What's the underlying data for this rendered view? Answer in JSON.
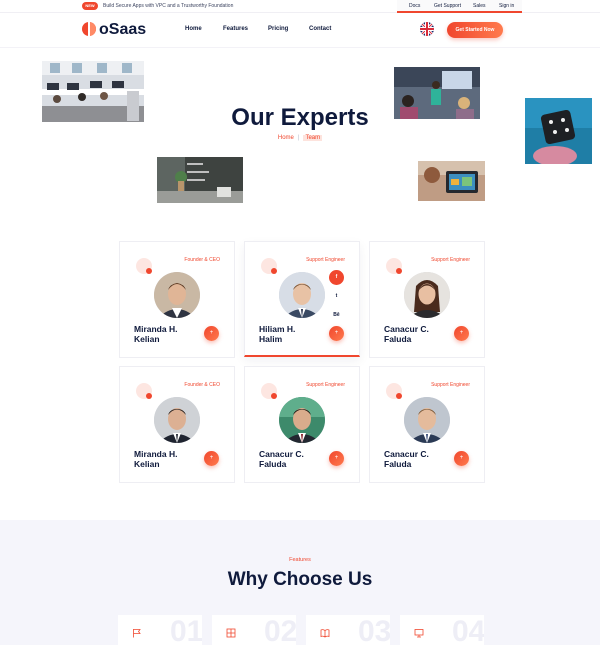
{
  "topbar": {
    "badge": "NEW",
    "announcement": "Build Secure Apps with VPC and a Trustworthy Foundation",
    "links": [
      "Docs",
      "Get Support",
      "Sales",
      "Sign in"
    ]
  },
  "header": {
    "logo_text": "oSaas",
    "nav": [
      "Home",
      "Features",
      "Pricing",
      "Contact"
    ],
    "cta": "Get Started Now"
  },
  "hero": {
    "title": "Our Experts",
    "breadcrumb_home": "Home",
    "breadcrumb_sep": "|",
    "breadcrumb_current": "Team"
  },
  "team": [
    {
      "role": "Founder & CEO",
      "name_line1": "Miranda H.",
      "name_line2": "Kelian",
      "plus": "+"
    },
    {
      "role": "Support Engineer",
      "name_line1": "Hiliam H.",
      "name_line2": "Halim",
      "plus": "+",
      "social": [
        "f",
        "t",
        "Bē"
      ]
    },
    {
      "role": "Support Engineer",
      "name_line1": "Canacur C.",
      "name_line2": "Faluda",
      "plus": "+"
    },
    {
      "role": "Founder & CEO",
      "name_line1": "Miranda H.",
      "name_line2": "Kelian",
      "plus": "+"
    },
    {
      "role": "Support Engineer",
      "name_line1": "Canacur C.",
      "name_line2": "Faluda",
      "plus": "+"
    },
    {
      "role": "Support Engineer",
      "name_line1": "Canacur C.",
      "name_line2": "Faluda",
      "plus": "+"
    }
  ],
  "features": {
    "label": "Features",
    "title": "Why Choose Us",
    "items": [
      {
        "number": "01",
        "icon": "flag-icon"
      },
      {
        "number": "02",
        "icon": "grid-icon"
      },
      {
        "number": "03",
        "icon": "book-icon"
      },
      {
        "number": "04",
        "icon": "monitor-icon"
      }
    ]
  },
  "colors": {
    "accent": "#f0472e",
    "navy": "#0f1a3c",
    "section_bg": "#f5f5fb"
  }
}
